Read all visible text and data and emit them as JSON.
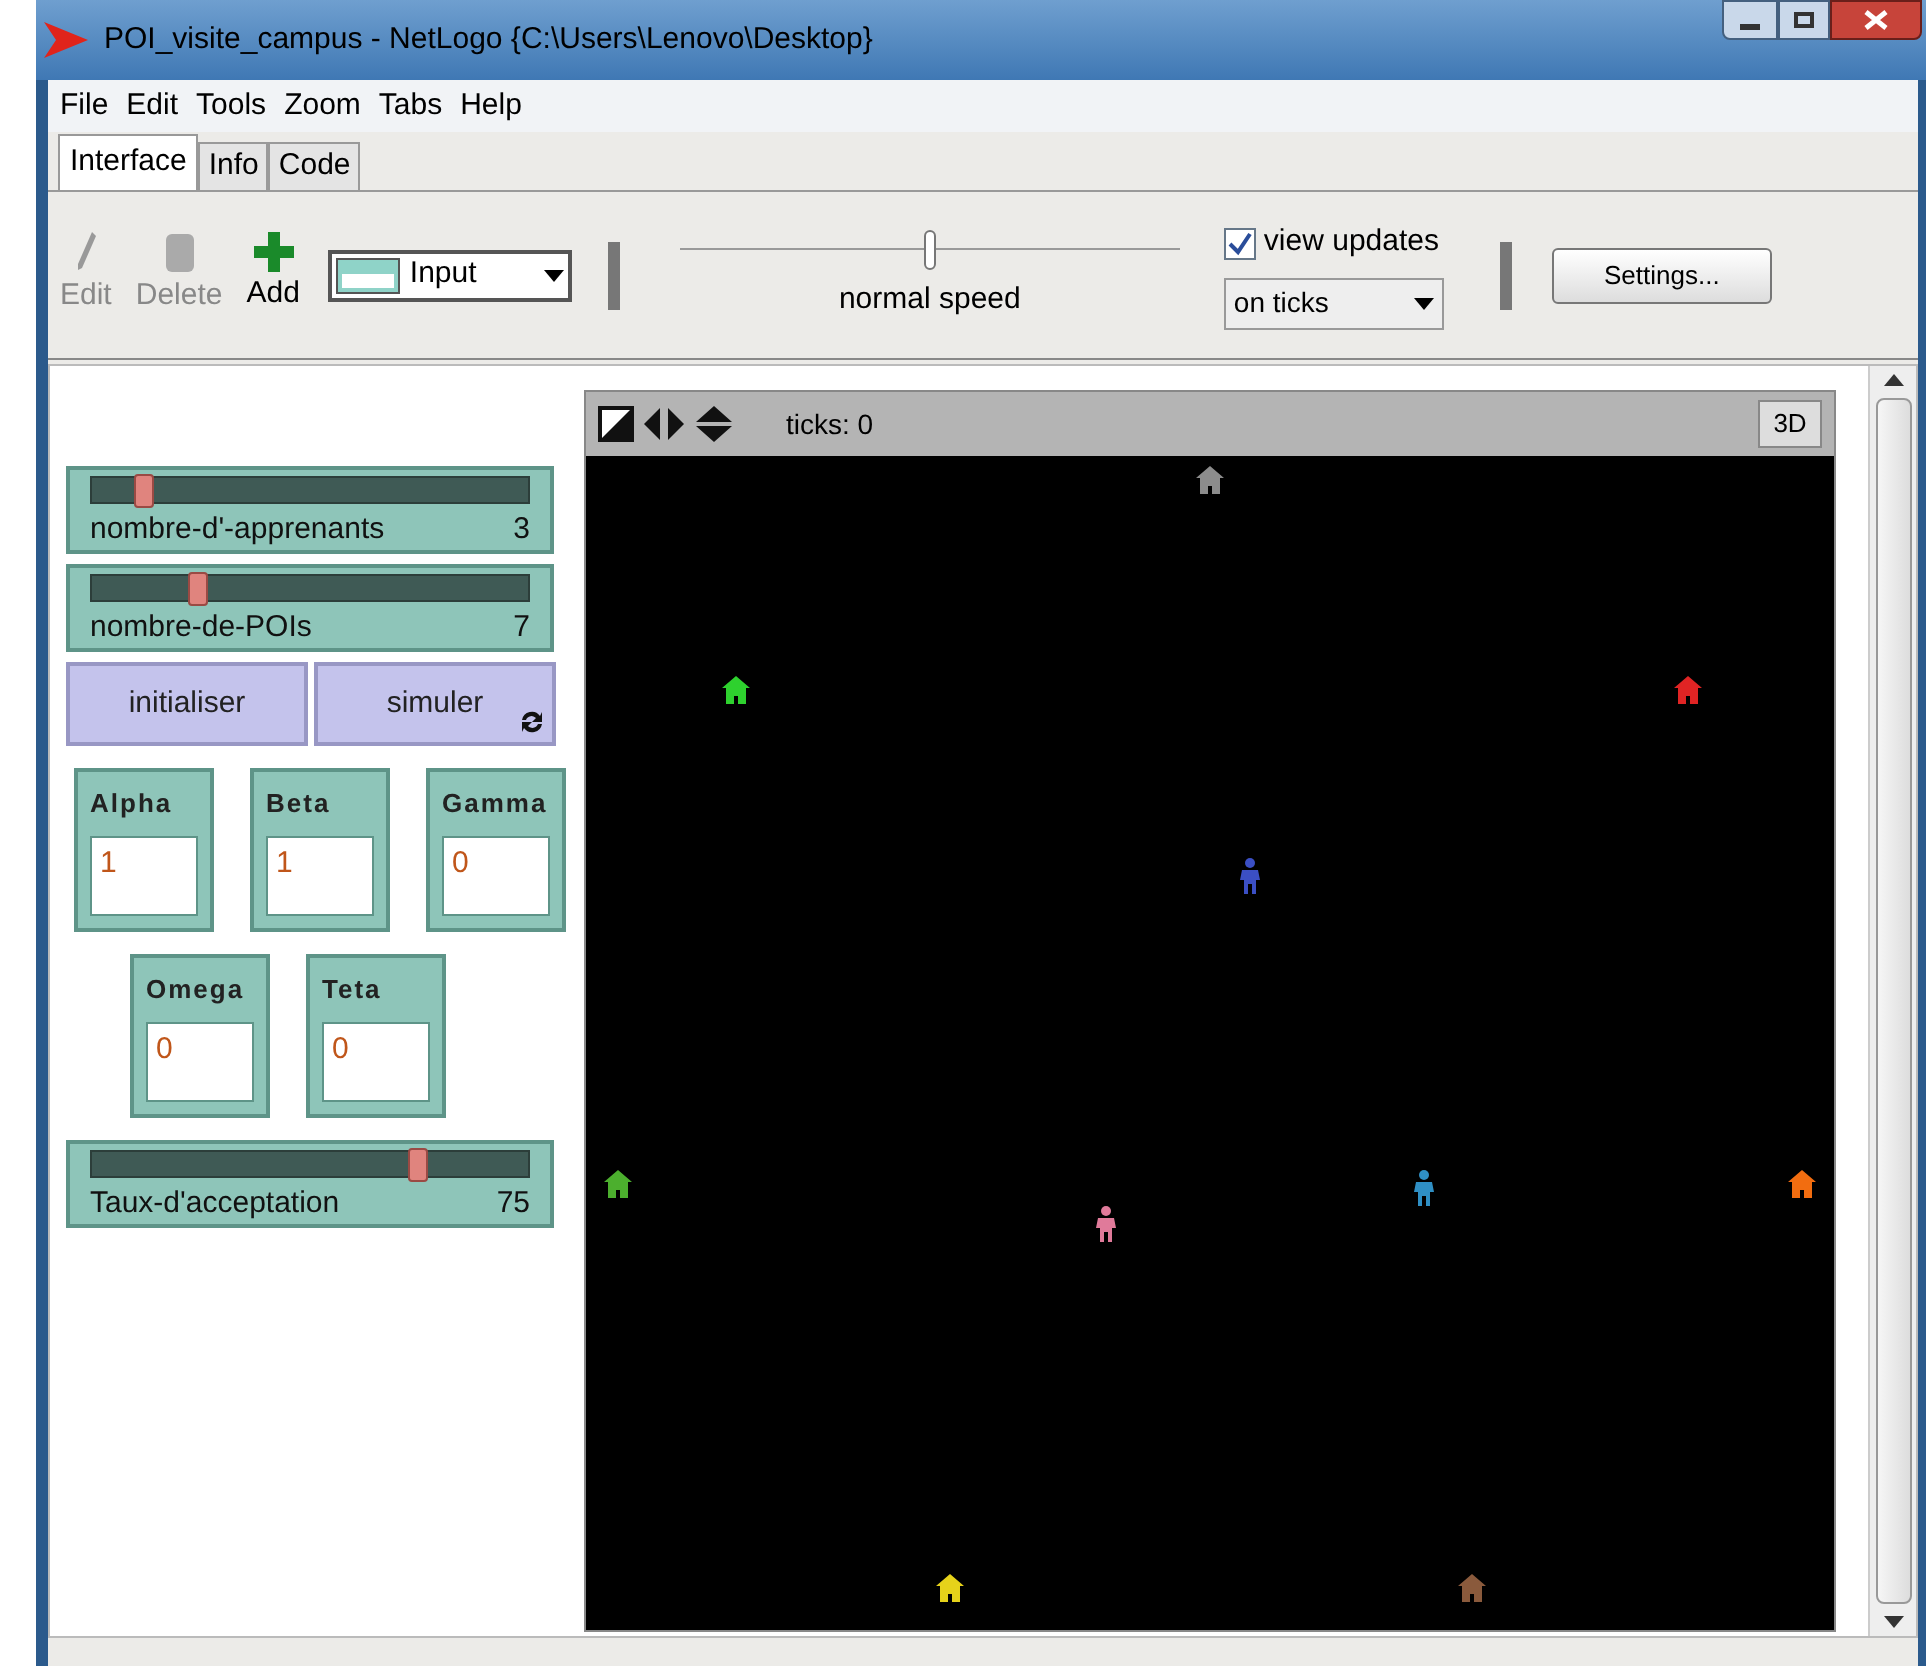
{
  "window": {
    "title": "POI_visite_campus - NetLogo {C:\\Users\\Lenovo\\Desktop}"
  },
  "menu": [
    "File",
    "Edit",
    "Tools",
    "Zoom",
    "Tabs",
    "Help"
  ],
  "tabs": [
    {
      "label": "Interface",
      "selected": true
    },
    {
      "label": "Info",
      "selected": false
    },
    {
      "label": "Code",
      "selected": false
    }
  ],
  "toolbar": {
    "edit": {
      "label": "Edit",
      "disabled": true
    },
    "delete": {
      "label": "Delete",
      "disabled": true
    },
    "add": {
      "label": "Add",
      "disabled": false
    },
    "widget_type": "Input",
    "speed": {
      "label": "normal speed",
      "level": 0.5
    },
    "view_updates": {
      "label": "view updates",
      "checked": true
    },
    "update_mode": "on ticks",
    "settings": "Settings..."
  },
  "widgets": [
    {
      "kind": "slider",
      "label": "nombre-d'-apprenants",
      "value": "3",
      "level": 0.1
    },
    {
      "kind": "slider",
      "label": "nombre-de-POIs",
      "value": "7",
      "level": 0.23
    },
    {
      "kind": "buttons",
      "items": [
        {
          "label": "initialiser",
          "forever": false
        },
        {
          "label": "simuler",
          "forever": true
        }
      ]
    },
    {
      "kind": "inputs",
      "items": [
        {
          "label": "Alpha",
          "value": "1"
        },
        {
          "label": "Beta",
          "value": "1"
        },
        {
          "label": "Gamma",
          "value": "0"
        }
      ]
    },
    {
      "kind": "inputs",
      "items": [
        {
          "label": "Omega",
          "value": "0"
        },
        {
          "label": "Teta",
          "value": "0"
        }
      ]
    },
    {
      "kind": "slider",
      "label": "Taux-d'acceptation",
      "value": "75",
      "level": 0.75
    }
  ],
  "view": {
    "ticks": "ticks: 0",
    "button_3d": "3D",
    "agents": [
      {
        "kind": "house",
        "color": "#8c8c8c"
      },
      {
        "kind": "house",
        "color": "#2ed12e"
      },
      {
        "kind": "house",
        "color": "#e02424"
      },
      {
        "kind": "person",
        "color": "#3b4fc4"
      },
      {
        "kind": "house",
        "color": "#4caf2e"
      },
      {
        "kind": "person",
        "color": "#2f8fc4"
      },
      {
        "kind": "person",
        "color": "#e07a9a"
      },
      {
        "kind": "house",
        "color": "#f26d10"
      },
      {
        "kind": "house",
        "color": "#e6d21a"
      },
      {
        "kind": "house",
        "color": "#8a5a3c"
      }
    ]
  }
}
